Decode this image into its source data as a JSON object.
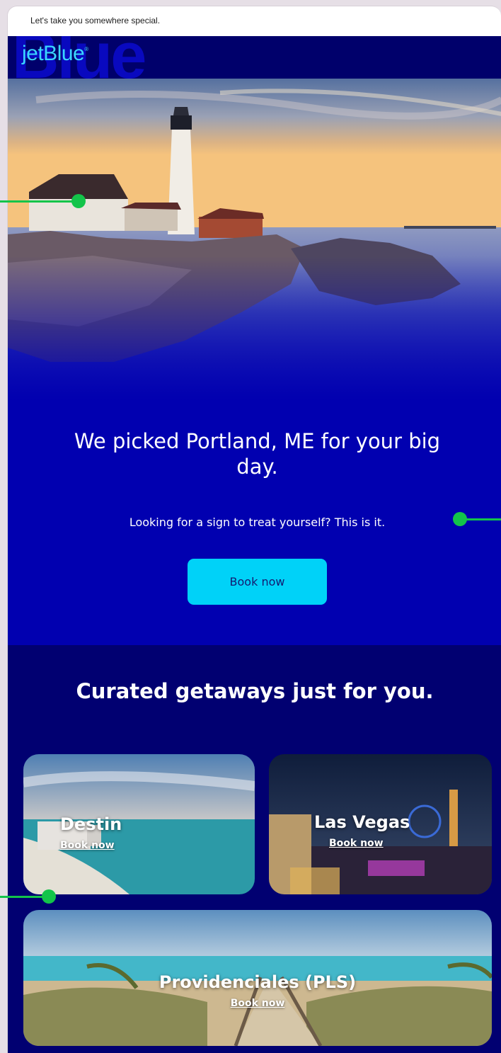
{
  "preheader": "Let's take you somewhere special.",
  "brand": {
    "logo_text": "jetBlue",
    "ghost_text": "Blue"
  },
  "hero": {
    "headline": "We picked Portland, ME for your big day.",
    "subline": "Looking for a sign to treat yourself? This is it.",
    "cta_label": "Book now"
  },
  "getaways": {
    "title": "Curated getaways just for you.",
    "cards": [
      {
        "name": "Destin",
        "link": "Book now"
      },
      {
        "name": "Las Vegas",
        "link": "Book now"
      },
      {
        "name": "Providenciales (PLS)",
        "link": "Book now"
      }
    ]
  },
  "colors": {
    "brand_navy": "#00006b",
    "hero_blue": "#0100b0",
    "section_navy": "#010071",
    "cta_cyan": "#00d2f8",
    "logo_cyan": "#3ad6ff",
    "pointer_green": "#13c44a"
  }
}
